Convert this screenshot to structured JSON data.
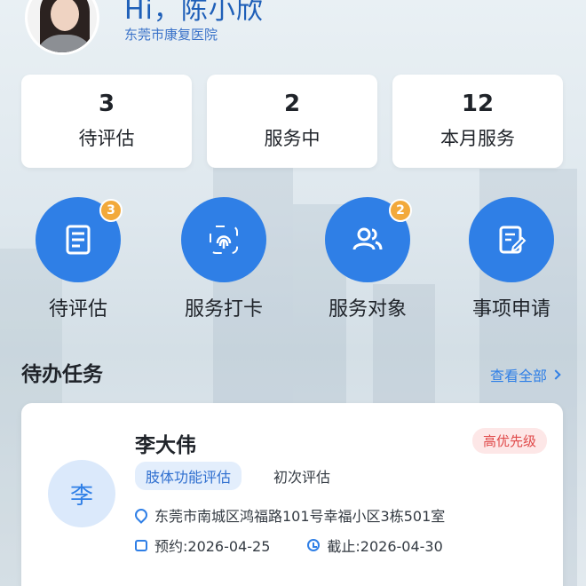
{
  "header": {
    "greeting": "Hi，陈小欣",
    "hospital": "东莞市康复医院"
  },
  "stats": [
    {
      "value": "3",
      "label": "待评估"
    },
    {
      "value": "2",
      "label": "服务中"
    },
    {
      "value": "12",
      "label": "本月服务"
    }
  ],
  "actions": [
    {
      "label": "待评估",
      "icon": "document-icon",
      "badge": "3"
    },
    {
      "label": "服务打卡",
      "icon": "fingerprint-icon",
      "badge": ""
    },
    {
      "label": "服务对象",
      "icon": "users-icon",
      "badge": "2"
    },
    {
      "label": "事项申请",
      "icon": "form-edit-icon",
      "badge": ""
    }
  ],
  "tasks_section": {
    "title": "待办任务",
    "view_all": "查看全部"
  },
  "task": {
    "avatar_char": "李",
    "name": "李大伟",
    "priority": "高优先级",
    "tag": "肢体功能评估",
    "assess_type": "初次评估",
    "address": "东莞市南城区鸿福路101号幸福小区3栋501室",
    "appointment": "预约:2026-04-25",
    "deadline": "截止:2026-04-30"
  },
  "colors": {
    "accent": "#2f7fe6",
    "badge": "#f2a93b",
    "priority_text": "#e04a4a",
    "priority_bg": "#fde7e7"
  }
}
